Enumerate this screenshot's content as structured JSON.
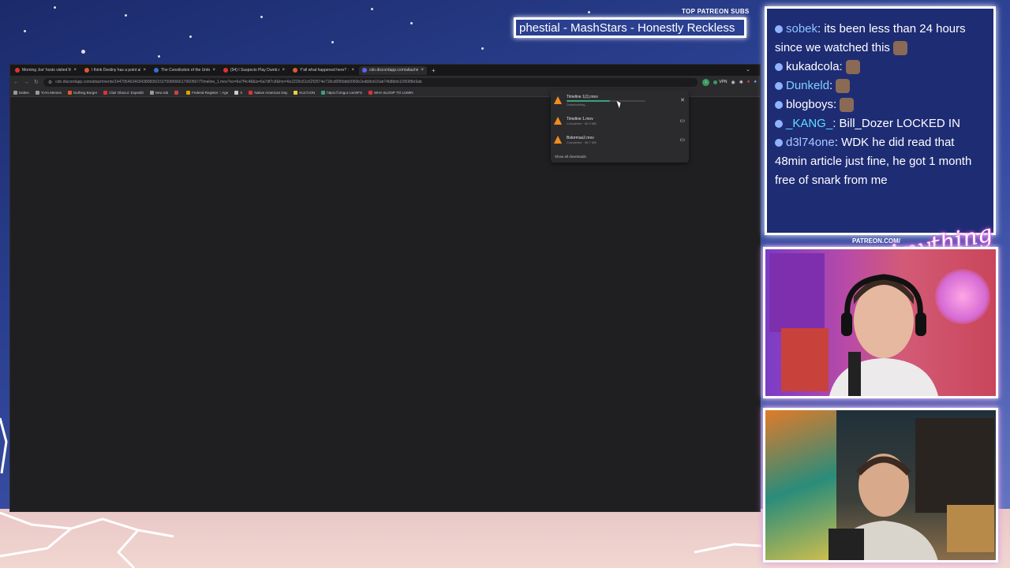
{
  "overlay": {
    "patreon_label": "TOP PATREON SUBS",
    "ticker_text": "phestial - MashStars - Honestly Reckless",
    "patreon_url": "PATREON.COM/",
    "signature": "Anything Else"
  },
  "chat": {
    "messages": [
      {
        "user": "sobek",
        "user_color": "#8ec5ff",
        "text": ": its been less than 24 hours since we watched this",
        "emote": true
      },
      {
        "user": "kukadcola",
        "user_color": "#ffffff",
        "text": ":",
        "emote": true
      },
      {
        "user": "Dunkeld",
        "user_color": "#7fd3ff",
        "text": ":",
        "emote": true
      },
      {
        "user": "blogboys",
        "user_color": "#ffffff",
        "text": ":",
        "emote": true
      },
      {
        "user": "_KANG_",
        "user_color": "#5ee0ff",
        "text": ": Bill_Dozer LOCKED IN",
        "emote": false
      },
      {
        "user": "d3l74one",
        "user_color": "#a9c8ff",
        "text": ": WDK he did read that 48min article just fine, he got 1 month free of snark from me",
        "emote": false
      }
    ]
  },
  "browser": {
    "tabs": [
      {
        "title": "Morning Joe' hosts visited Ma",
        "color": "#d33"
      },
      {
        "title": "I think Destiny has a point abo",
        "color": "#e05a2b"
      },
      {
        "title": "The Constitution of the United",
        "color": "#3b6cd6"
      },
      {
        "title": "(94) I Suspects Play Dumb Aft",
        "color": "#d33"
      },
      {
        "title": "Y'all what happened here? : r/l",
        "color": "#e05a2b"
      },
      {
        "title": "cdn.discordapp.com/attachments/",
        "color": "#5865f2"
      }
    ],
    "url": "cdn.discordapp.com/attachments/1447954634034380836/1537508666617900567/Timeline_1.mov?ex=6a7f4c48&is=6a7df7c8&hm=6e2229c61c62f2574e718cd095bbb0060b2edb8cb16ab74b8bbb11f6088e9ab",
    "vpn_label": "VPN",
    "bookmarks": [
      {
        "label": "Daltes",
        "color": "#999"
      },
      {
        "label": "YoYo Memes",
        "color": "#999"
      },
      {
        "label": "Nothing Burger",
        "color": "#e05a2b"
      },
      {
        "label": "Clair Obscur: Expediti",
        "color": "#d33"
      },
      {
        "label": "New tab",
        "color": "#999"
      },
      {
        "label": "",
        "color": "#c44"
      },
      {
        "label": "Federal Register :: Age",
        "color": "#e0a000"
      },
      {
        "label": "X",
        "color": "#ccc"
      },
      {
        "label": "Native American Day",
        "color": "#d33"
      },
      {
        "label": "KULT.ION",
        "color": "#e8d040"
      },
      {
        "label": "https://i.imgur.com/IFS",
        "color": "#3aa27a"
      },
      {
        "label": "WHA SLOOP TO LUMIN",
        "color": "#d33"
      }
    ],
    "downloads": [
      {
        "name": "Timeline 1(1).mov",
        "status": "Downloading...",
        "progress": 0.55
      },
      {
        "name": "Timeline 1.mov",
        "status": "Completed · 66.3 MB",
        "progress": 1.0
      },
      {
        "name": "Bstormas2.mov",
        "status": "Completed · 98.7 MB",
        "progress": 1.0
      }
    ],
    "show_all": "Show all downloads"
  }
}
